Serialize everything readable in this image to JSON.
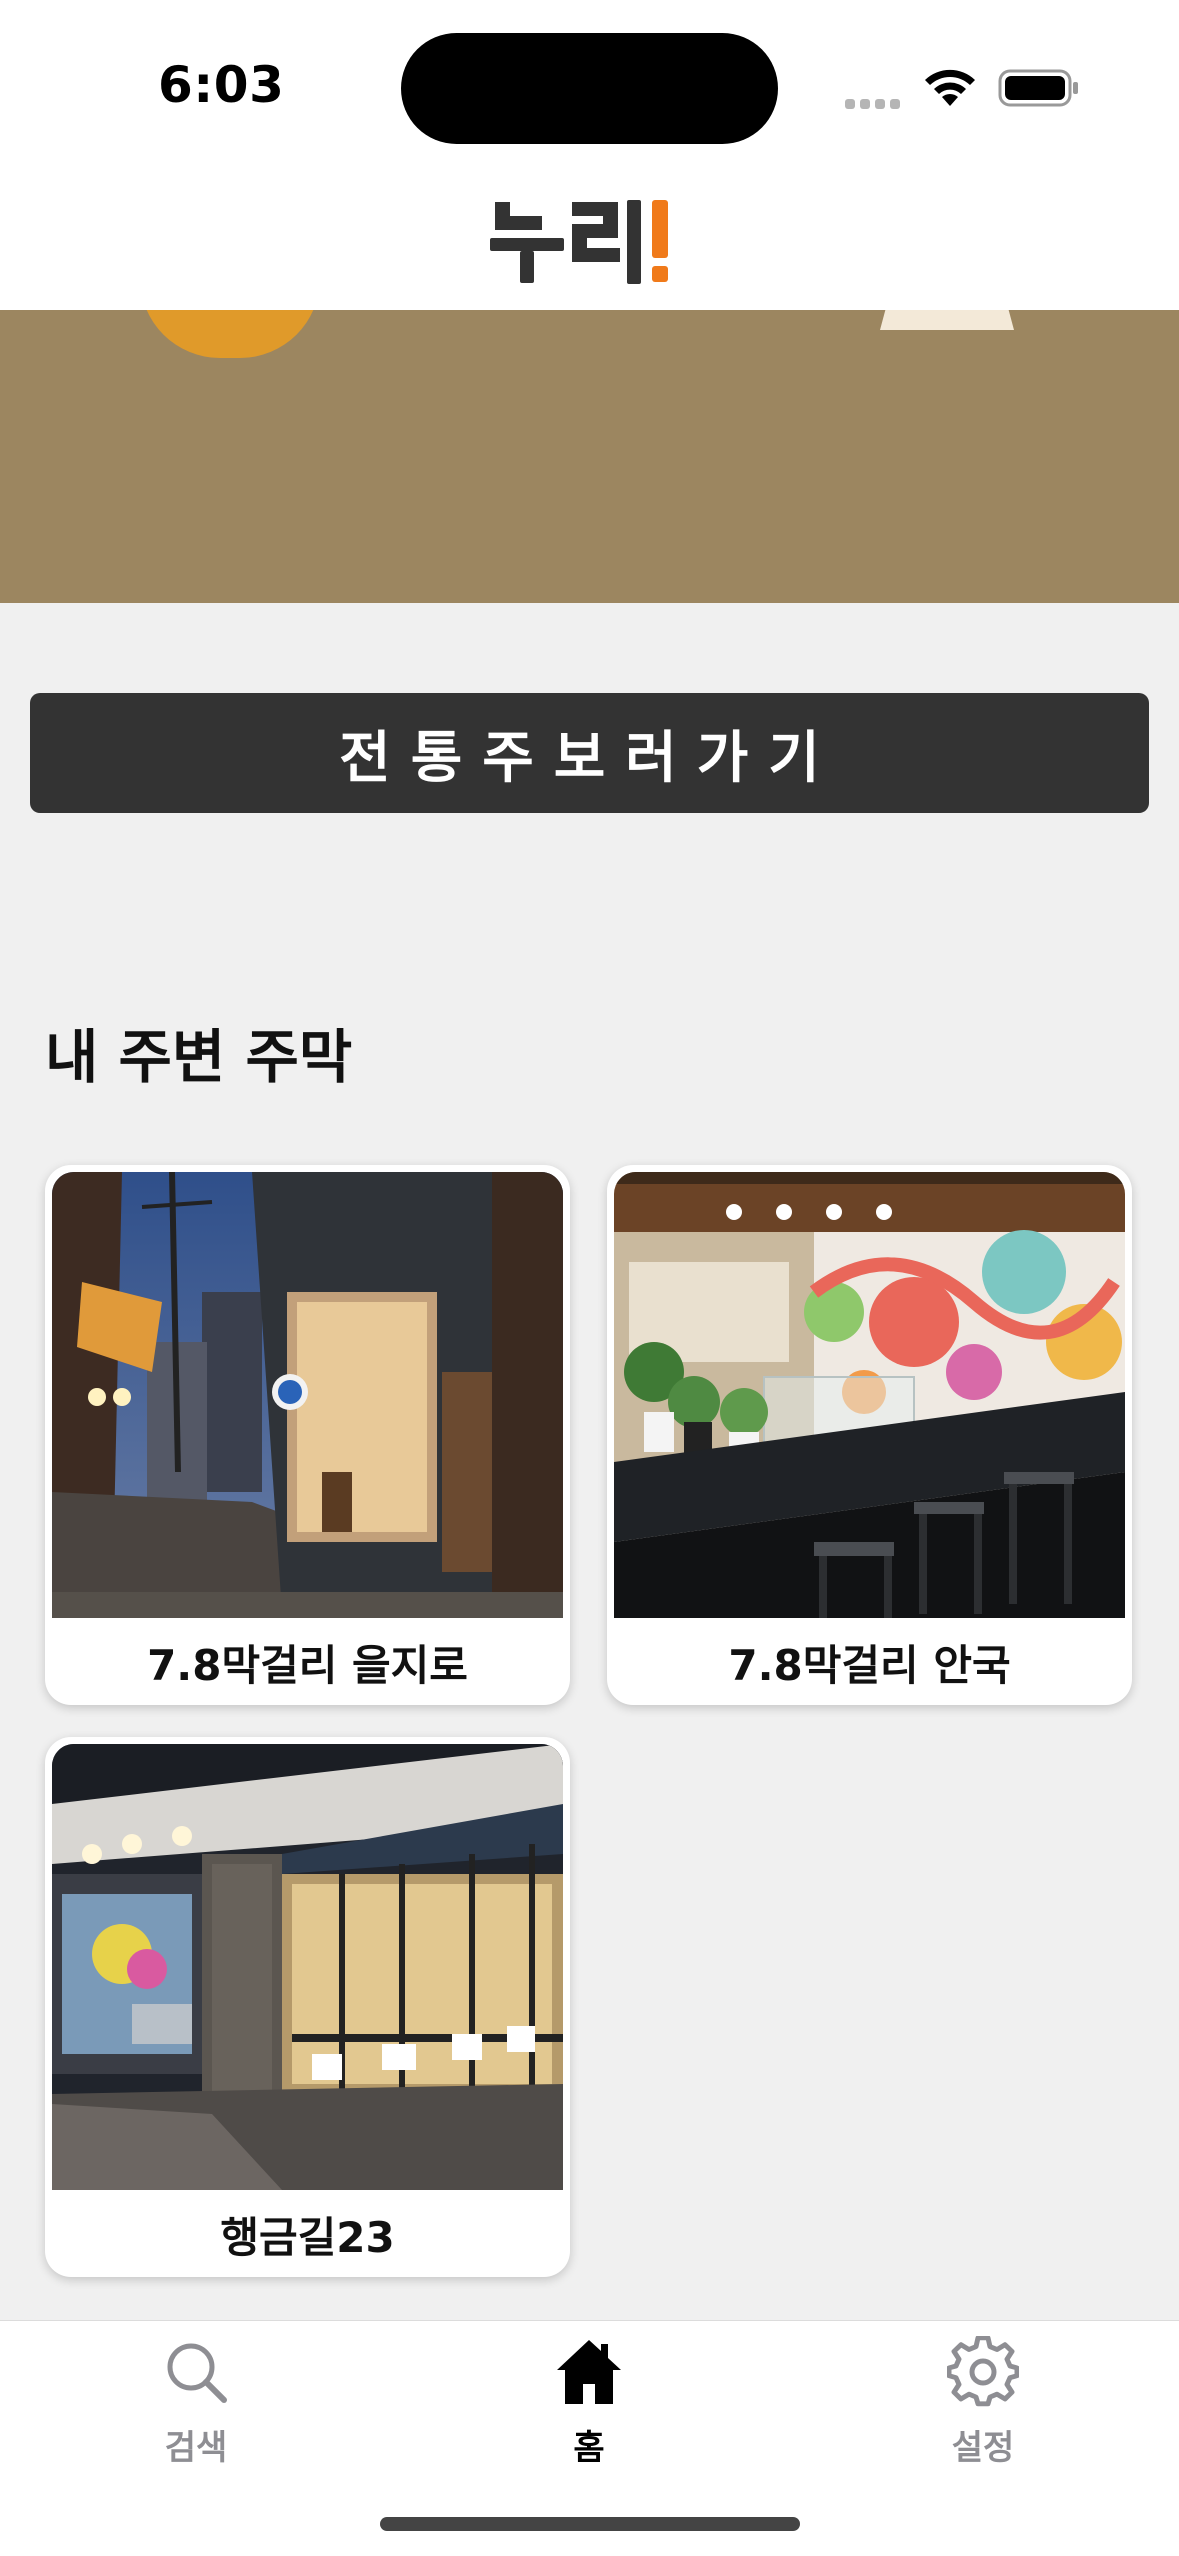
{
  "status_bar": {
    "time": "6:03"
  },
  "app": {
    "logo_text": "누리!",
    "brand_colors": {
      "dark": "#333333",
      "accent": "#f07a1a"
    }
  },
  "banner": {
    "background_color": "#9c8660"
  },
  "cta": {
    "label": "전통주보러가기"
  },
  "nearby": {
    "title": "내 주변 주막",
    "items": [
      {
        "name": "7.8막걸리 을지로",
        "photo": "street-night-storefront"
      },
      {
        "name": "7.8막걸리 안국",
        "photo": "bar-interior-mural"
      },
      {
        "name": "행금길23",
        "photo": "corner-building-night"
      }
    ]
  },
  "tabs": [
    {
      "label": "검색",
      "icon": "search-icon",
      "active": false
    },
    {
      "label": "홈",
      "icon": "home-icon",
      "active": true
    },
    {
      "label": "설정",
      "icon": "gear-icon",
      "active": false
    }
  ]
}
